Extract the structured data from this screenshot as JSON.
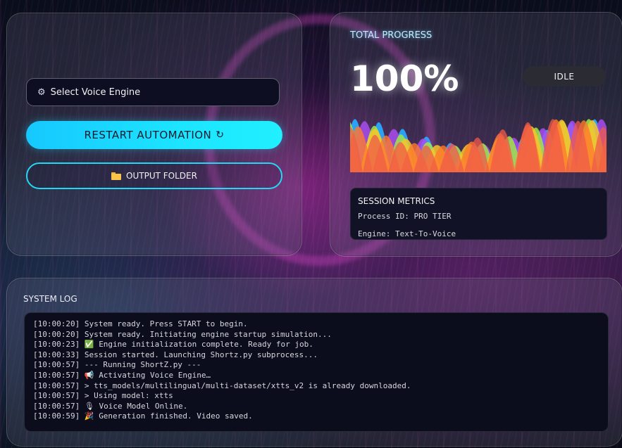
{
  "left": {
    "voice_select": {
      "icon": "gear-icon",
      "label": "Select Voice Engine"
    },
    "restart_button": {
      "label": "RESTART AUTOMATION",
      "icon": "refresh-icon"
    },
    "output_button": {
      "label": "OUTPUT FOLDER",
      "icon": "folder-icon"
    }
  },
  "progress": {
    "title": "TOTAL PROGRESS",
    "value": "100%",
    "percent": 100,
    "status": "IDLE"
  },
  "metrics": {
    "title": "SESSION METRICS",
    "process_id": "Process ID: PRO TIER",
    "engine": "Engine: Text-To-Voice"
  },
  "log": {
    "title": "SYSTEM LOG",
    "lines": [
      {
        "time": "[10:00:20]",
        "icon": "",
        "text": "System ready. Press START to begin."
      },
      {
        "time": "[10:00:20]",
        "icon": "",
        "text": "System ready. Initiating engine startup simulation..."
      },
      {
        "time": "[10:00:23]",
        "icon": "✅",
        "text": "Engine initialization complete. Ready for job."
      },
      {
        "time": "[10:00:33]",
        "icon": "",
        "text": "Session started. Launching Shortz.py subprocess..."
      },
      {
        "time": "[10:00:57]",
        "icon": "",
        "text": "--- Running ShortZ.py ---"
      },
      {
        "time": "[10:00:57]",
        "icon": "📢",
        "text": "Activating Voice Engine…"
      },
      {
        "time": "[10:00:57]",
        "icon": "",
        "text": "> tts_models/multilingual/multi-dataset/xtts_v2 is already downloaded."
      },
      {
        "time": "[10:00:57]",
        "icon": "",
        "text": "> Using model: xtts"
      },
      {
        "time": "[10:00:57]",
        "icon": "🎙",
        "text": "Voice Model Online."
      },
      {
        "time": "[10:00:59]",
        "icon": "🎉",
        "text": "Generation finished. Video saved."
      }
    ]
  },
  "colors": {
    "accent_cyan": "#1de4ff",
    "background": "#0a0d1c",
    "wave_colors": [
      "#f05a4a",
      "#f7c52a",
      "#9ee84a",
      "#2aa8ff",
      "#a84df0",
      "#ff7a2a"
    ]
  }
}
